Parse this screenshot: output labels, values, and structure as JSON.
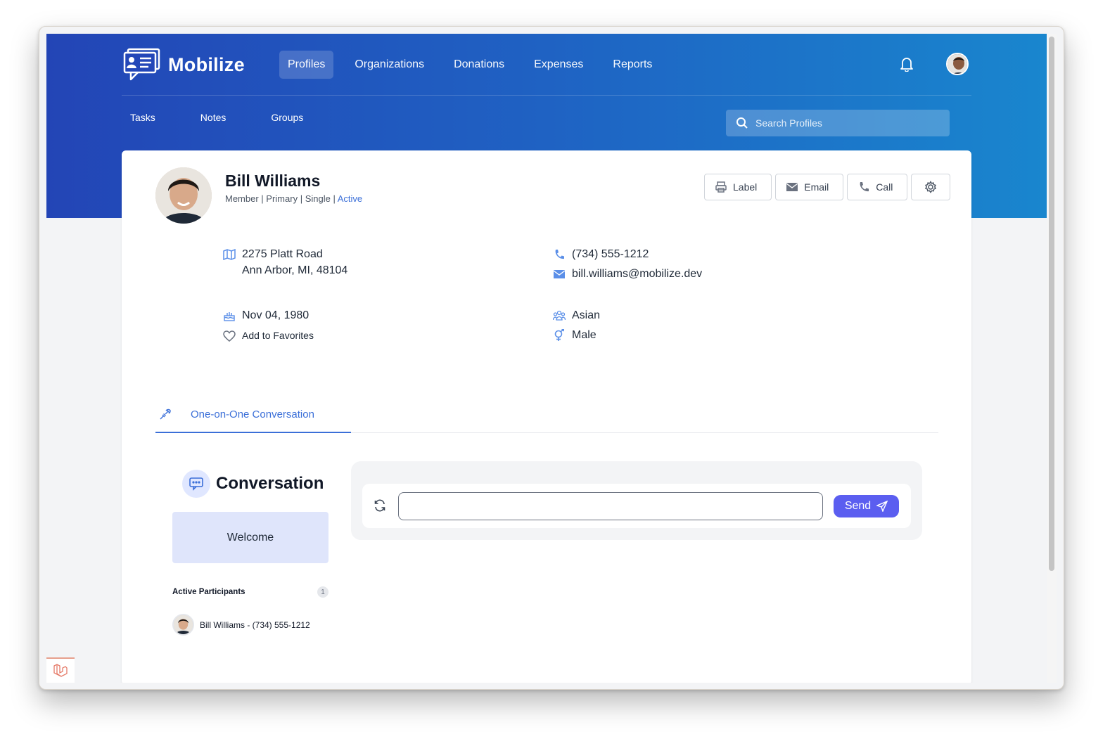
{
  "brand": {
    "name": "Mobilize"
  },
  "nav": {
    "items": [
      {
        "label": "Profiles",
        "active": true
      },
      {
        "label": "Organizations",
        "active": false
      },
      {
        "label": "Donations",
        "active": false
      },
      {
        "label": "Expenses",
        "active": false
      },
      {
        "label": "Reports",
        "active": false
      }
    ]
  },
  "subnav": {
    "items": [
      "Tasks",
      "Notes",
      "Groups"
    ]
  },
  "search": {
    "placeholder": "Search Profiles",
    "value": ""
  },
  "profile": {
    "name": "Bill Williams",
    "meta": [
      "Member",
      "Primary",
      "Single"
    ],
    "status": "Active",
    "address_line1": "2275 Platt Road",
    "address_line2": "Ann Arbor, MI, 48104",
    "phone": "(734) 555-1212",
    "email": "bill.williams@mobilize.dev",
    "birthdate": "Nov 04, 1980",
    "favorites_label": "Add to Favorites",
    "ethnicity": "Asian",
    "gender": "Male"
  },
  "actions": {
    "label": "Label",
    "email": "Email",
    "call": "Call"
  },
  "tabs": [
    {
      "label": "One-on-One Conversation",
      "active": true
    }
  ],
  "conversation": {
    "title": "Conversation",
    "welcome": "Welcome",
    "participants_label": "Active Participants",
    "participants_count": "1",
    "participant": "Bill Williams - (734) 555-1212",
    "message_placeholder": "",
    "send_label": "Send"
  },
  "colors": {
    "primary": "#3b6fd8",
    "send": "#5b5ef0",
    "hero_start": "#2345b6",
    "hero_end": "#1986ce"
  },
  "icons": [
    "logo-icon",
    "bell-icon",
    "search-icon",
    "printer-icon",
    "envelope-icon",
    "phone-icon",
    "gear-icon",
    "map-icon",
    "cake-icon",
    "heart-icon",
    "users-icon",
    "gender-icon",
    "plug-icon",
    "chat-icon",
    "refresh-icon",
    "send-icon",
    "laravel-icon"
  ]
}
